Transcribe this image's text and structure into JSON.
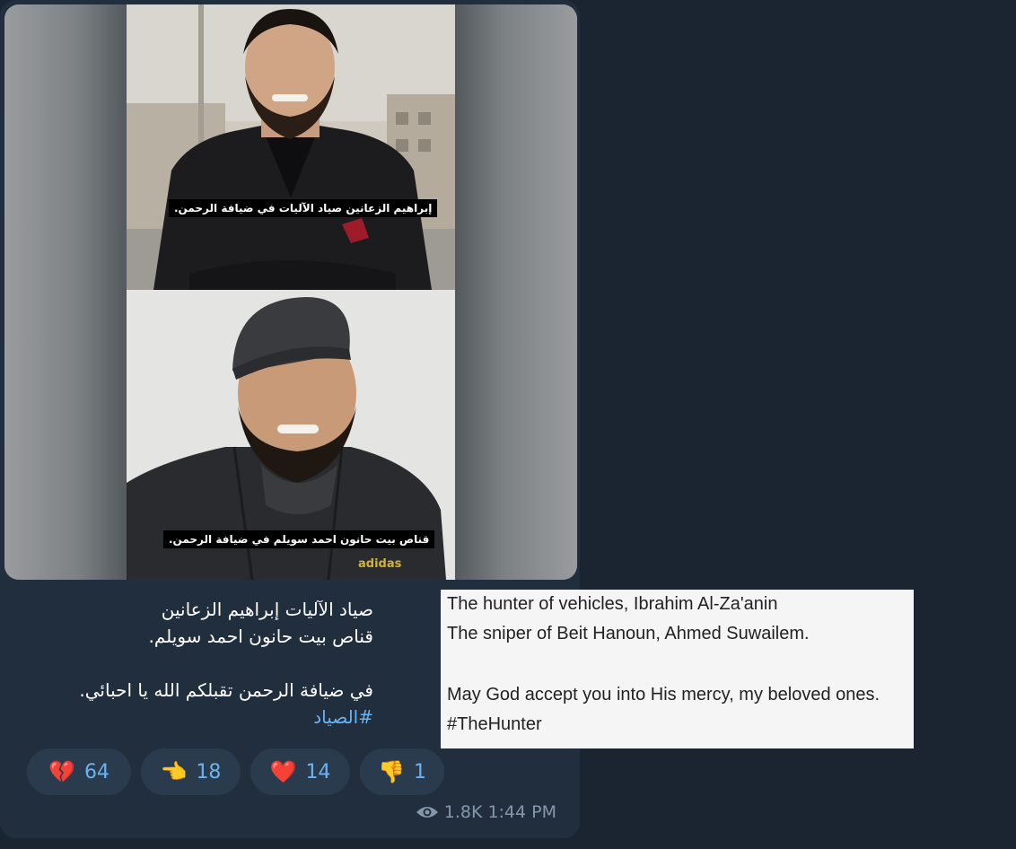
{
  "media": {
    "top_caption": "إبراهيم الزعانين صياد الآليات في ضيافة الرحمن.",
    "bottom_caption": "قناص بيت حانون احمد سويلم في ضيافة الرحمن.",
    "jacket_logo": "adidas"
  },
  "message": {
    "line1": "صياد الآليات إبراهيم الزعانين",
    "line2": "قناص بيت حانون احمد سويلم.",
    "line3": "في ضيافة الرحمن تقبلكم الله يا احبائي.",
    "hashtag": "#الصياد"
  },
  "reactions": [
    {
      "emoji": "💔",
      "icon": "broken-heart-icon",
      "count": "64"
    },
    {
      "emoji": "👈",
      "icon": "pointing-hand-icon",
      "count": "18"
    },
    {
      "emoji": "❤️",
      "icon": "heart-icon",
      "count": "14"
    },
    {
      "emoji": "👎",
      "icon": "thumbs-down-icon",
      "count": "1"
    }
  ],
  "meta": {
    "views": "1.8K",
    "time": "1:44 PM"
  },
  "translation": {
    "line1": "The hunter of vehicles, Ibrahim Al-Za'anin",
    "line2": "The sniper of Beit Hanoun, Ahmed Suwailem.",
    "line3": "May God accept you into His mercy, my beloved ones.",
    "line4": "#TheHunter"
  },
  "colors": {
    "background": "#1b2532",
    "bubble": "#212e3d",
    "reaction_pill": "#2b3b4e",
    "link": "#6ab2f2",
    "meta": "#8598aa"
  }
}
